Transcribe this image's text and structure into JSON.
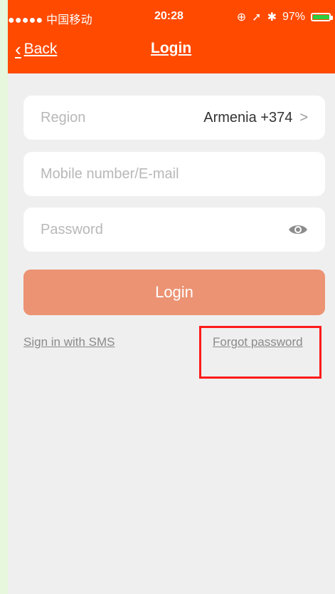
{
  "status_bar": {
    "carrier": "●●●●● 中国移动",
    "wifi_icon": "wifi-icon",
    "time": "20:28",
    "battery_percent": "97%",
    "battery_level": 0.97
  },
  "nav": {
    "back_label": "Back",
    "title": "Login"
  },
  "form": {
    "region_label": "Region",
    "region_value": "Armenia +374",
    "mobile_placeholder": "Mobile number/E-mail",
    "password_placeholder": "Password",
    "login_button": "Login"
  },
  "links": {
    "sms_signin": "Sign in with SMS",
    "forgot_password": "Forgot password"
  },
  "colors": {
    "header_bg": "#ff4a00",
    "login_button_bg": "#ec9373",
    "highlight_border": "#ff1a1a",
    "page_bg": "#efefef"
  }
}
